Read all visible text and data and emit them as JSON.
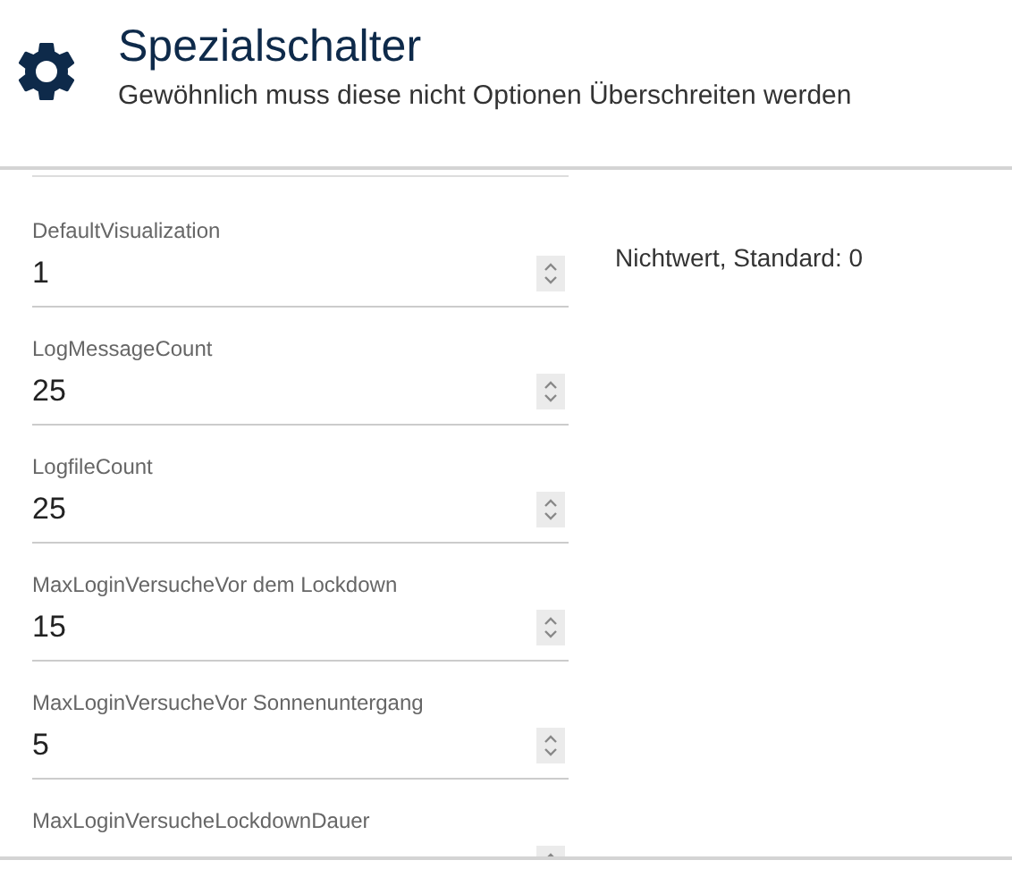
{
  "header": {
    "title": "Spezialschalter",
    "subtitle": "Gewöhnlich muss diese nicht Optionen Überschreiten werden"
  },
  "fields": [
    {
      "label": "DefaultVisualization",
      "value": "1",
      "hint": "Nichtwert, Standard: 0"
    },
    {
      "label": "LogMessageCount",
      "value": "25"
    },
    {
      "label": "LogfileCount",
      "value": "25"
    },
    {
      "label": "MaxLoginVersucheVor dem Lockdown",
      "value": "15"
    },
    {
      "label": "MaxLoginVersucheVor Sonnenuntergang",
      "value": "5"
    },
    {
      "label": "MaxLoginVersucheLockdownDauer"
    }
  ]
}
